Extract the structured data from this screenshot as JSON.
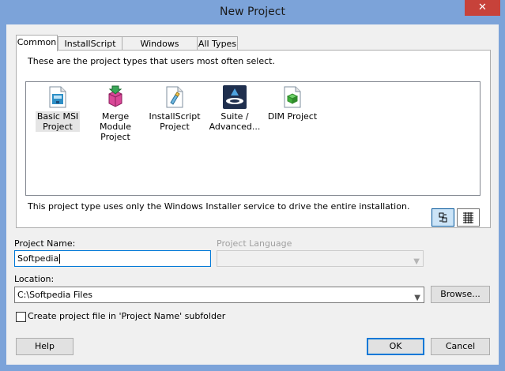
{
  "window": {
    "title": "New Project",
    "close_glyph": "✕"
  },
  "tabs": [
    {
      "label": "Common",
      "active": true
    },
    {
      "label": "InstallScript",
      "active": false
    },
    {
      "label": "Windows Installer",
      "active": false
    },
    {
      "label": "All Types",
      "active": false
    }
  ],
  "panel": {
    "description": "These are the project types that users most often select.",
    "project_types": [
      {
        "label_line1": "Basic MSI",
        "label_line2": "Project",
        "icon": "basic-msi-icon",
        "selected": true
      },
      {
        "label_line1": "Merge Module",
        "label_line2": "Project",
        "icon": "merge-module-icon",
        "selected": false
      },
      {
        "label_line1": "InstallScript",
        "label_line2": "Project",
        "icon": "installscript-icon",
        "selected": false
      },
      {
        "label_line1": "Suite /",
        "label_line2": "Advanced...",
        "icon": "suite-icon",
        "selected": false
      },
      {
        "label_line1": "DIM Project",
        "label_line2": "",
        "icon": "dim-project-icon",
        "selected": false
      }
    ],
    "type_description": "This project type uses only the Windows Installer service to drive the entire installation."
  },
  "form": {
    "project_name_label": "Project Name:",
    "project_name_value": "Softpedia",
    "project_language_label": "Project Language",
    "project_language_value": "",
    "location_label": "Location:",
    "location_value": "C:\\Softpedia Files",
    "browse_label": "Browse...",
    "subfolder_label": "Create project file in 'Project Name' subfolder",
    "subfolder_checked": false
  },
  "buttons": {
    "help": "Help",
    "ok": "OK",
    "cancel": "Cancel"
  },
  "colors": {
    "title_bar": "#7ca3d9",
    "close_button": "#c7423a",
    "dialog_bg": "#f0f0f0",
    "focus_blue": "#0078d7"
  }
}
